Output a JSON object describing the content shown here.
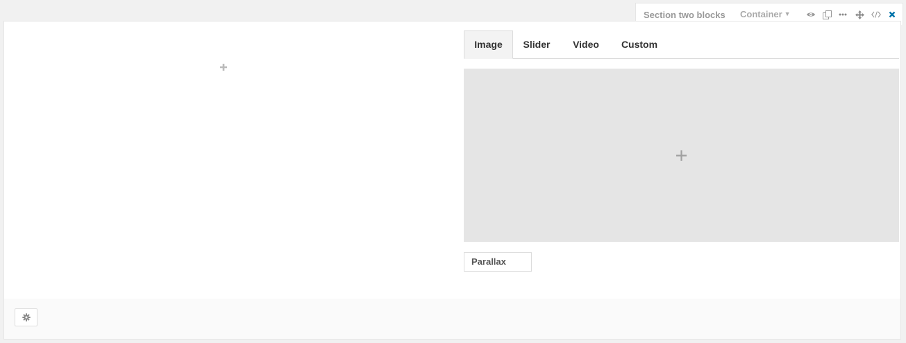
{
  "toolbar": {
    "title": "Section two blocks",
    "container_label": "Container",
    "icons": [
      "eye-icon",
      "duplicate-icon",
      "more-icon",
      "move-icon",
      "code-icon",
      "close-icon"
    ]
  },
  "content": {
    "tabs": [
      {
        "label": "Image",
        "active": true
      },
      {
        "label": "Slider",
        "active": false
      },
      {
        "label": "Video",
        "active": false
      },
      {
        "label": "Custom",
        "active": false
      }
    ],
    "parallax_label": "Parallax"
  },
  "colors": {
    "close": "#0073aa",
    "tab_active_bg": "#f3f3f3",
    "dropzone_bg": "#e5e5e5"
  }
}
